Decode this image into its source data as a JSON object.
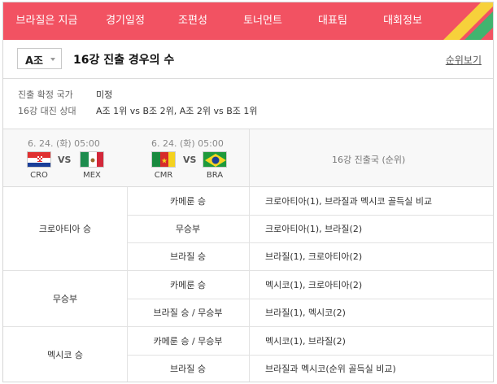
{
  "nav": {
    "tabs": [
      "브라질은 지금",
      "경기일정",
      "조편성",
      "토너먼트",
      "대표팀",
      "대회정보"
    ],
    "color": "#f25262",
    "stripe_colors": [
      "#f7d13b",
      "#41b46f"
    ]
  },
  "group": {
    "selected": "A조",
    "title": "16강 진출 경우의 수",
    "rank_link": "순위보기"
  },
  "info": {
    "status_label": "진출 확정 국가",
    "status_value": "미정",
    "opponent_label": "16강 대진 상대",
    "opponent_value": "A조 1위 vs B조 2위, A조 2위 vs B조 1위"
  },
  "matches": [
    {
      "date": "6. 24. (화) 05:00",
      "home": {
        "code": "CRO",
        "flag": "croatia-flag"
      },
      "vs": "VS",
      "away": {
        "code": "MEX",
        "flag": "mexico-flag"
      }
    },
    {
      "date": "6. 24. (화) 05:00",
      "home": {
        "code": "CMR",
        "flag": "cameroon-flag"
      },
      "vs": "VS",
      "away": {
        "code": "BRA",
        "flag": "brazil-flag"
      }
    }
  ],
  "qualifier_header": "16강 진출국 (순위)",
  "scenarios": [
    {
      "result_a": "크로아티아 승",
      "rows": [
        {
          "result_b": "카메룬 승",
          "qualifiers": "크로아티아(1), 브라질과 멕시코 골득실 비교"
        },
        {
          "result_b": "무승부",
          "qualifiers": "크로아티아(1), 브라질(2)"
        },
        {
          "result_b": "브라질 승",
          "qualifiers": "브라질(1), 크로아티아(2)"
        }
      ]
    },
    {
      "result_a": "무승부",
      "rows": [
        {
          "result_b": "카메룬 승",
          "qualifiers": "멕시코(1), 크로아티아(2)"
        },
        {
          "result_b": "브라질 승 / 무승부",
          "qualifiers": "브라질(1), 멕시코(2)"
        }
      ]
    },
    {
      "result_a": "멕시코 승",
      "rows": [
        {
          "result_b": "카메룬 승 / 무승부",
          "qualifiers": "멕시코(1), 브라질(2)"
        },
        {
          "result_b": "브라질 승",
          "qualifiers": "브라질과 멕시코(순위 골득실 비교)"
        }
      ]
    }
  ]
}
